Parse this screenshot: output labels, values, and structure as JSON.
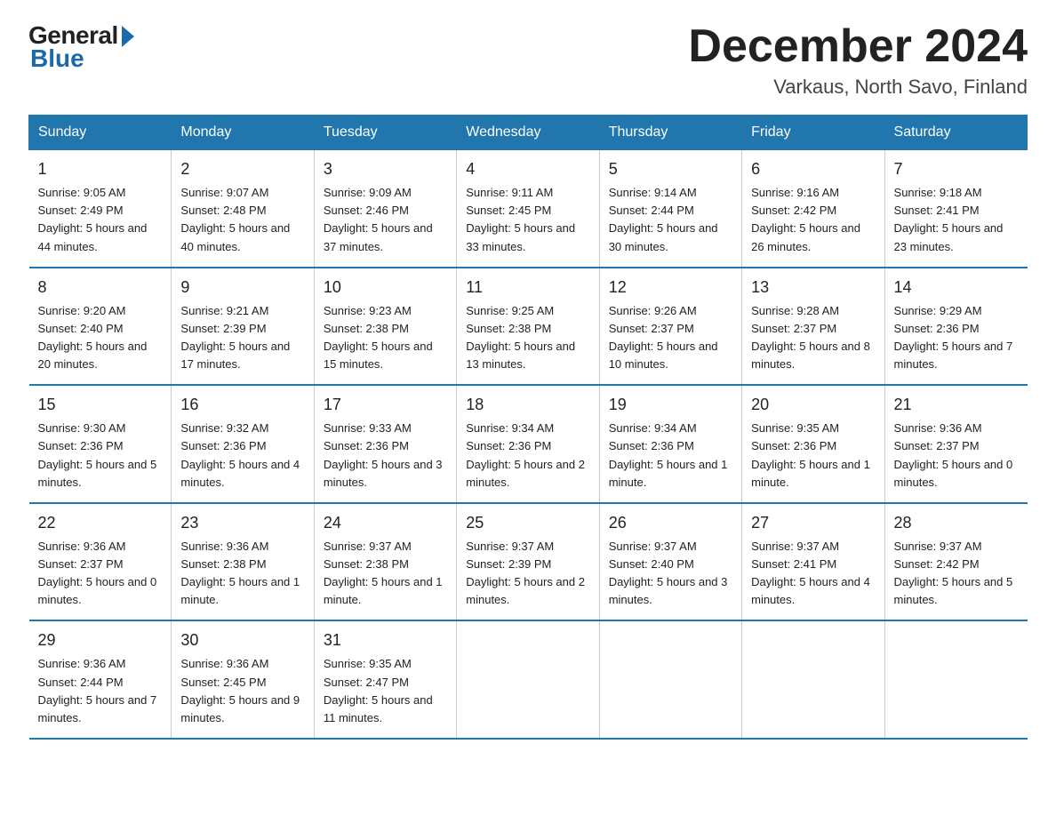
{
  "logo": {
    "general": "General",
    "blue": "Blue"
  },
  "header": {
    "month": "December 2024",
    "location": "Varkaus, North Savo, Finland"
  },
  "weekdays": [
    "Sunday",
    "Monday",
    "Tuesday",
    "Wednesday",
    "Thursday",
    "Friday",
    "Saturday"
  ],
  "weeks": [
    [
      {
        "day": "1",
        "sunrise": "9:05 AM",
        "sunset": "2:49 PM",
        "daylight": "5 hours and 44 minutes."
      },
      {
        "day": "2",
        "sunrise": "9:07 AM",
        "sunset": "2:48 PM",
        "daylight": "5 hours and 40 minutes."
      },
      {
        "day": "3",
        "sunrise": "9:09 AM",
        "sunset": "2:46 PM",
        "daylight": "5 hours and 37 minutes."
      },
      {
        "day": "4",
        "sunrise": "9:11 AM",
        "sunset": "2:45 PM",
        "daylight": "5 hours and 33 minutes."
      },
      {
        "day": "5",
        "sunrise": "9:14 AM",
        "sunset": "2:44 PM",
        "daylight": "5 hours and 30 minutes."
      },
      {
        "day": "6",
        "sunrise": "9:16 AM",
        "sunset": "2:42 PM",
        "daylight": "5 hours and 26 minutes."
      },
      {
        "day": "7",
        "sunrise": "9:18 AM",
        "sunset": "2:41 PM",
        "daylight": "5 hours and 23 minutes."
      }
    ],
    [
      {
        "day": "8",
        "sunrise": "9:20 AM",
        "sunset": "2:40 PM",
        "daylight": "5 hours and 20 minutes."
      },
      {
        "day": "9",
        "sunrise": "9:21 AM",
        "sunset": "2:39 PM",
        "daylight": "5 hours and 17 minutes."
      },
      {
        "day": "10",
        "sunrise": "9:23 AM",
        "sunset": "2:38 PM",
        "daylight": "5 hours and 15 minutes."
      },
      {
        "day": "11",
        "sunrise": "9:25 AM",
        "sunset": "2:38 PM",
        "daylight": "5 hours and 13 minutes."
      },
      {
        "day": "12",
        "sunrise": "9:26 AM",
        "sunset": "2:37 PM",
        "daylight": "5 hours and 10 minutes."
      },
      {
        "day": "13",
        "sunrise": "9:28 AM",
        "sunset": "2:37 PM",
        "daylight": "5 hours and 8 minutes."
      },
      {
        "day": "14",
        "sunrise": "9:29 AM",
        "sunset": "2:36 PM",
        "daylight": "5 hours and 7 minutes."
      }
    ],
    [
      {
        "day": "15",
        "sunrise": "9:30 AM",
        "sunset": "2:36 PM",
        "daylight": "5 hours and 5 minutes."
      },
      {
        "day": "16",
        "sunrise": "9:32 AM",
        "sunset": "2:36 PM",
        "daylight": "5 hours and 4 minutes."
      },
      {
        "day": "17",
        "sunrise": "9:33 AM",
        "sunset": "2:36 PM",
        "daylight": "5 hours and 3 minutes."
      },
      {
        "day": "18",
        "sunrise": "9:34 AM",
        "sunset": "2:36 PM",
        "daylight": "5 hours and 2 minutes."
      },
      {
        "day": "19",
        "sunrise": "9:34 AM",
        "sunset": "2:36 PM",
        "daylight": "5 hours and 1 minute."
      },
      {
        "day": "20",
        "sunrise": "9:35 AM",
        "sunset": "2:36 PM",
        "daylight": "5 hours and 1 minute."
      },
      {
        "day": "21",
        "sunrise": "9:36 AM",
        "sunset": "2:37 PM",
        "daylight": "5 hours and 0 minutes."
      }
    ],
    [
      {
        "day": "22",
        "sunrise": "9:36 AM",
        "sunset": "2:37 PM",
        "daylight": "5 hours and 0 minutes."
      },
      {
        "day": "23",
        "sunrise": "9:36 AM",
        "sunset": "2:38 PM",
        "daylight": "5 hours and 1 minute."
      },
      {
        "day": "24",
        "sunrise": "9:37 AM",
        "sunset": "2:38 PM",
        "daylight": "5 hours and 1 minute."
      },
      {
        "day": "25",
        "sunrise": "9:37 AM",
        "sunset": "2:39 PM",
        "daylight": "5 hours and 2 minutes."
      },
      {
        "day": "26",
        "sunrise": "9:37 AM",
        "sunset": "2:40 PM",
        "daylight": "5 hours and 3 minutes."
      },
      {
        "day": "27",
        "sunrise": "9:37 AM",
        "sunset": "2:41 PM",
        "daylight": "5 hours and 4 minutes."
      },
      {
        "day": "28",
        "sunrise": "9:37 AM",
        "sunset": "2:42 PM",
        "daylight": "5 hours and 5 minutes."
      }
    ],
    [
      {
        "day": "29",
        "sunrise": "9:36 AM",
        "sunset": "2:44 PM",
        "daylight": "5 hours and 7 minutes."
      },
      {
        "day": "30",
        "sunrise": "9:36 AM",
        "sunset": "2:45 PM",
        "daylight": "5 hours and 9 minutes."
      },
      {
        "day": "31",
        "sunrise": "9:35 AM",
        "sunset": "2:47 PM",
        "daylight": "5 hours and 11 minutes."
      },
      null,
      null,
      null,
      null
    ]
  ]
}
